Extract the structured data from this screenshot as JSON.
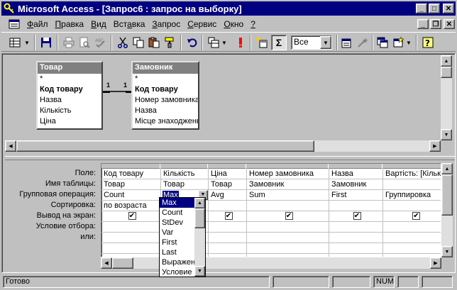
{
  "window": {
    "title": "Microsoft Access - [Запрос6 : запрос на выборку]"
  },
  "menu": {
    "items": [
      {
        "u": "Ф",
        "rest": "айл"
      },
      {
        "u": "П",
        "rest": "равка"
      },
      {
        "u": "В",
        "rest": "ид"
      },
      {
        "pre": "Вст",
        "u": "а",
        "rest": "вка"
      },
      {
        "u": "З",
        "rest": "апрос"
      },
      {
        "u": "С",
        "rest": "ервис"
      },
      {
        "u": "О",
        "rest": "кно"
      },
      {
        "u": "?",
        "rest": ""
      }
    ]
  },
  "toolbar": {
    "top_values": "Все"
  },
  "tables": [
    {
      "name": "Товар",
      "fields": [
        "*",
        "Код товару",
        "Назва",
        "Кількість",
        "Ціна"
      ]
    },
    {
      "name": "Замовник",
      "fields": [
        "*",
        "Код товару",
        "Номер замовника",
        "Назва",
        "Місце знаходження"
      ]
    }
  ],
  "relation": {
    "left": "1",
    "right": "1"
  },
  "grid": {
    "row_labels": [
      "Поле:",
      "Имя таблицы:",
      "Групповая операция:",
      "Сортировка:",
      "Вывод на экран:",
      "Условие отбора:",
      "или:"
    ],
    "columns": [
      {
        "field": "Код товару",
        "table": "Товар",
        "total": "Count",
        "sort": "по возраста",
        "show": true
      },
      {
        "field": "Кількість",
        "table": "Товар",
        "total": "Max",
        "sort": "",
        "show": true
      },
      {
        "field": "Ціна",
        "table": "Товар",
        "total": "Avg",
        "sort": "",
        "show": true
      },
      {
        "field": "Номер замовника",
        "table": "Замовник",
        "total": "Sum",
        "sort": "",
        "show": true
      },
      {
        "field": "Назва",
        "table": "Замовник",
        "total": "First",
        "sort": "",
        "show": true
      },
      {
        "field": "Вартість: [Кільк",
        "table": "",
        "total": "Группировка",
        "sort": "",
        "show": true
      }
    ]
  },
  "dropdown": {
    "options": [
      "Max",
      "Count",
      "StDev",
      "Var",
      "First",
      "Last",
      "Выражение",
      "Условие"
    ],
    "selected": "Max"
  },
  "status": {
    "text": "Готово",
    "num": "NUM"
  }
}
